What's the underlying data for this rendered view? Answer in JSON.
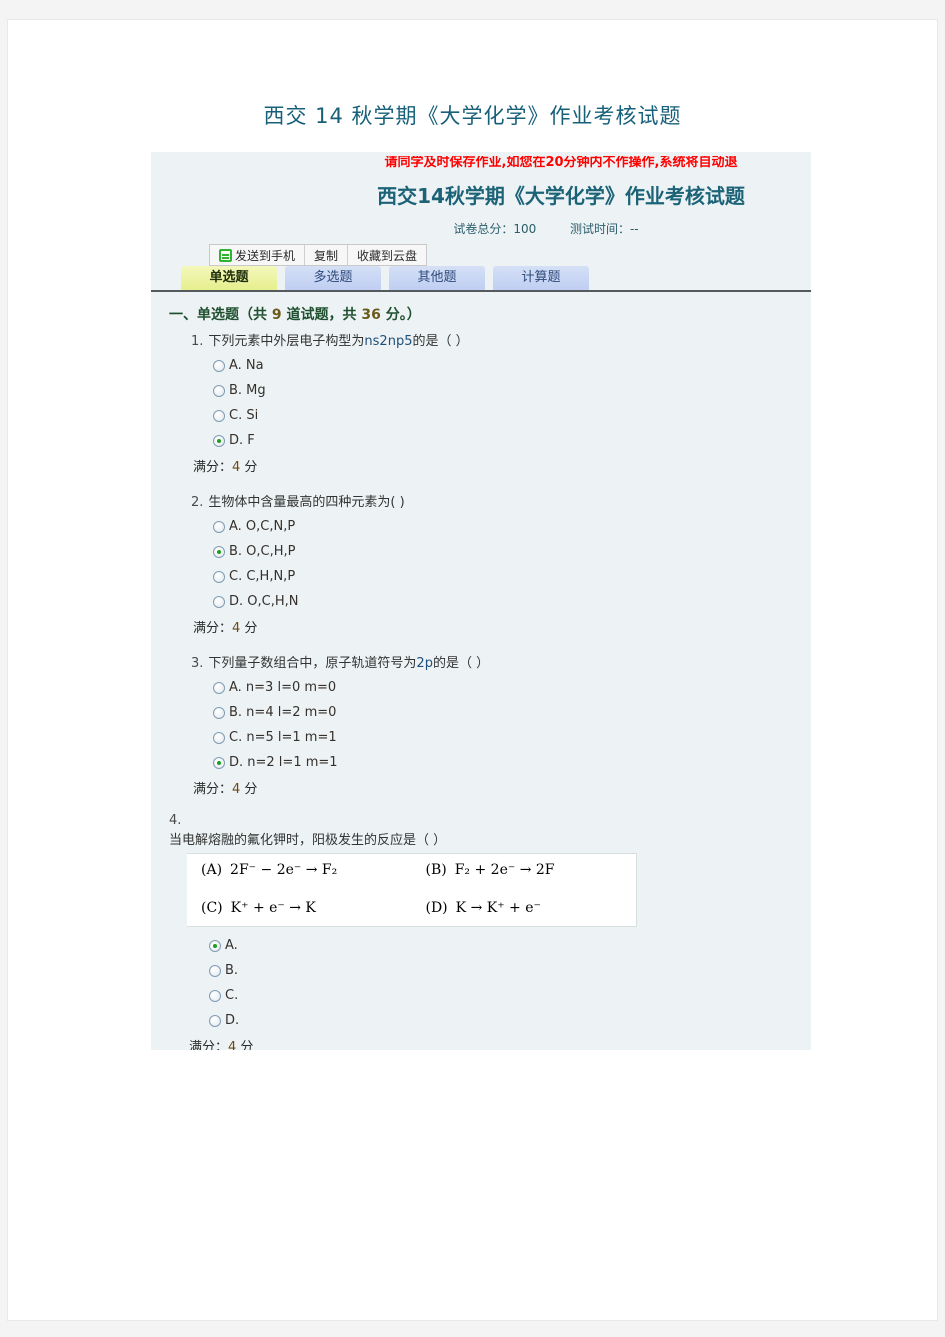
{
  "document": {
    "title": "西交 14 秋学期《大学化学》作业考核试题"
  },
  "exam": {
    "notice": "请同学及时保存作业,如您在20分钟内不作操作,系统将自动退",
    "title": "西交14秋学期《大学化学》作业考核试题",
    "total_score_label": "试卷总分：100",
    "test_time_label": "测试时间：--",
    "toolbar": {
      "send_to_phone": "发送到手机",
      "copy": "复制",
      "save_to_cloud": "收藏到云盘",
      "send_icon": "send-to-phone-icon"
    },
    "tabs": [
      {
        "label": "单选题",
        "active": true
      },
      {
        "label": "多选题",
        "active": false
      },
      {
        "label": "其他题",
        "active": false
      },
      {
        "label": "计算题",
        "active": false
      }
    ],
    "section": {
      "prefix": "一、单选题（共 ",
      "count": "9",
      "middle": " 道试题，共 ",
      "points": "36",
      "suffix": " 分。）"
    },
    "score_label": "满分：",
    "score_value": "4",
    "score_unit": " 分",
    "questions": [
      {
        "index": "1.",
        "stem_pre": "下列元素中外层电子构型为",
        "stem_hl": "ns2np5",
        "stem_post": "的是（ ）",
        "options": [
          {
            "label": "A. Na",
            "checked": false
          },
          {
            "label": "B. Mg",
            "checked": false
          },
          {
            "label": "C. Si",
            "checked": false
          },
          {
            "label": "D. F",
            "checked": true
          }
        ]
      },
      {
        "index": "2.",
        "stem_pre": "生物体中含量最高的四种元素为( )",
        "stem_hl": "",
        "stem_post": "",
        "options": [
          {
            "label": "A. O,C,N,P",
            "checked": false
          },
          {
            "label": "B. O,C,H,P",
            "checked": true
          },
          {
            "label": "C. C,H,N,P",
            "checked": false
          },
          {
            "label": "D. O,C,H,N",
            "checked": false
          }
        ]
      },
      {
        "index": "3.",
        "stem_pre": "下列量子数组合中，原子轨道符号为",
        "stem_hl": "2p",
        "stem_post": "的是（ ）",
        "options": [
          {
            "label": "A. n=3 l=0 m=0",
            "checked": false
          },
          {
            "label": "B. n=4 l=2 m=0",
            "checked": false
          },
          {
            "label": "C. n=5 l=1 m=1",
            "checked": false
          },
          {
            "label": "D. n=2 l=1 m=1",
            "checked": true
          }
        ]
      },
      {
        "index": "4.",
        "stem_pre": "当电解熔融的氟化钾时，阳极发生的反应是（ ）",
        "stem_hl": "",
        "stem_post": "",
        "formula": {
          "a_label": "(A)",
          "a_text": "2F⁻ − 2e⁻ → F₂",
          "b_label": "(B)",
          "b_text": "F₂ + 2e⁻ → 2F",
          "c_label": "(C)",
          "c_text": "K⁺ + e⁻ → K",
          "d_label": "(D)",
          "d_text": "K → K⁺ + e⁻"
        },
        "options": [
          {
            "label": "A.",
            "checked": true
          },
          {
            "label": "B.",
            "checked": false
          },
          {
            "label": "C.",
            "checked": false
          },
          {
            "label": "D.",
            "checked": false
          }
        ]
      }
    ]
  },
  "colors": {
    "doc_title": "#17607a",
    "notice_red": "#ff0000",
    "panel_bg": "#edf3f4",
    "active_tab": "#e6ef8e",
    "tab": "#bfcef2",
    "radio_dot": "#1f9e1f"
  }
}
